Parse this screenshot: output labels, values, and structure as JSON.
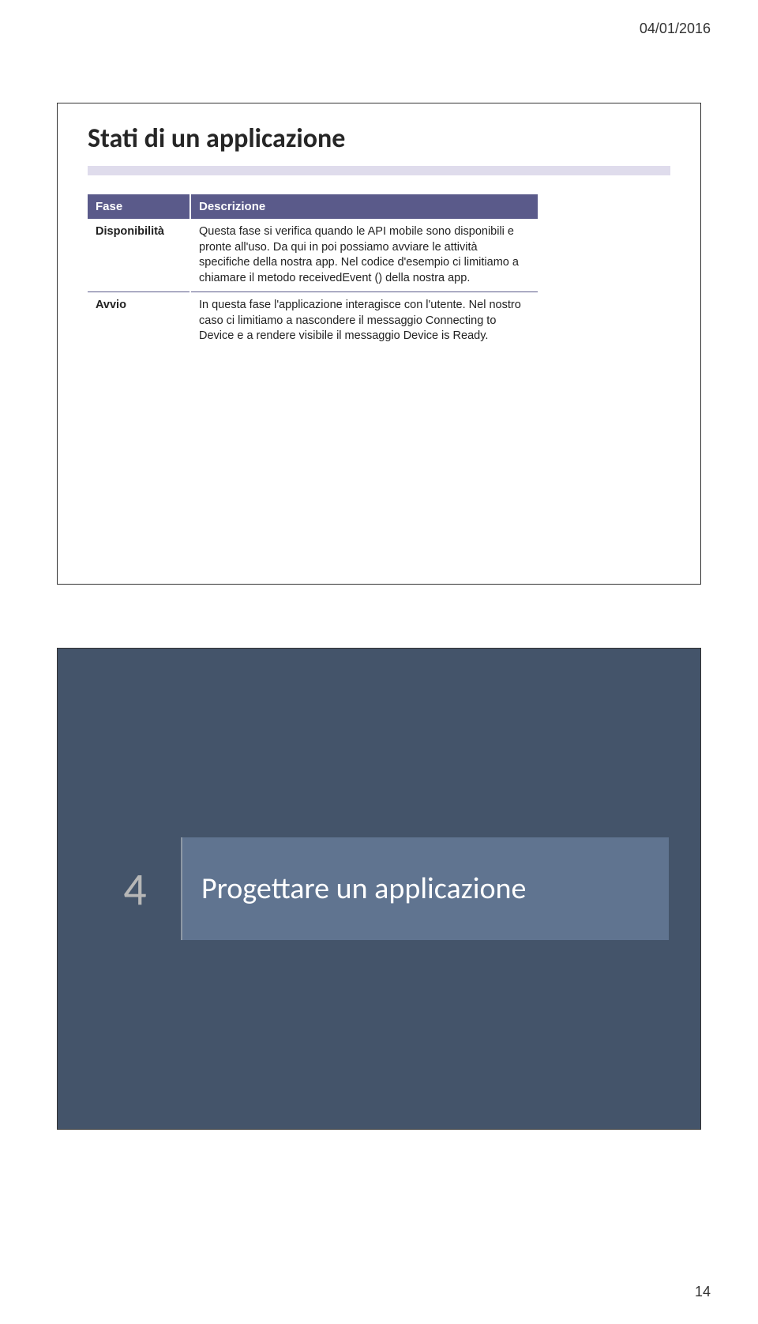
{
  "header": {
    "date": "04/01/2016"
  },
  "slide1": {
    "title": "Stati di un applicazione",
    "table": {
      "headers": {
        "col1": "Fase",
        "col2": "Descrizione"
      },
      "rows": [
        {
          "phase": "Disponibilità",
          "desc": "Questa fase si verifica quando le API mobile sono disponibili e pronte all'uso. Da qui in poi possiamo avviare le attività specifiche della nostra app. Nel codice d'esempio ci limitiamo a chiamare il metodo receivedEvent () della nostra app."
        },
        {
          "phase": "Avvio",
          "desc": "In questa fase l'applicazione interagisce con l'utente. Nel nostro caso ci limitiamo a nascondere il messaggio Connecting to Device e a rendere visibile il messaggio Device is Ready."
        }
      ]
    }
  },
  "slide2": {
    "number": "4",
    "title": "Progettare un applicazione"
  },
  "footer": {
    "page": "14"
  }
}
